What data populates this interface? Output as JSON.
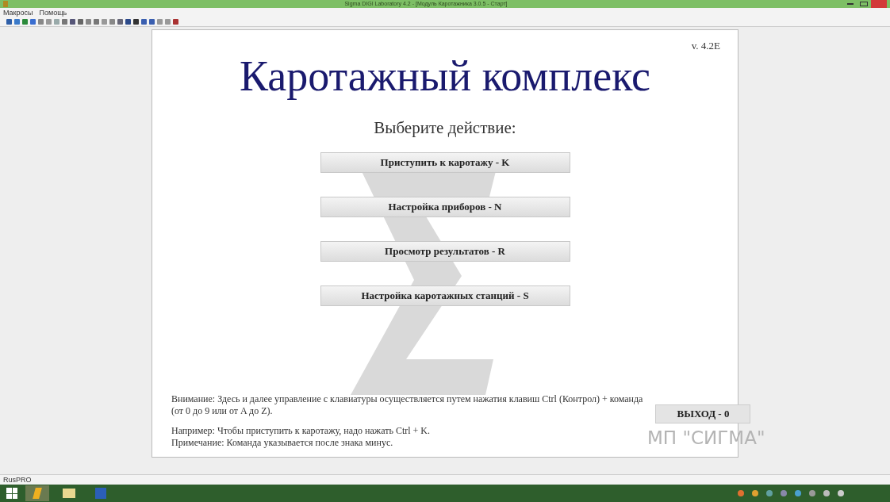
{
  "window": {
    "title": "Sigma DIGI Laboratory 4.2 - [Модуль Каротажника 3.0.5 - Старт]"
  },
  "menu": [
    "Макросы",
    "Помощь"
  ],
  "version": "v. 4.2E",
  "heading": "Каротажный комплекс",
  "prompt": "Выберите действие:",
  "actions": [
    "Приступить к каротажу - K",
    "Настройка приборов - N",
    "Просмотр результатов - R",
    "Настройка каротажных станций - S"
  ],
  "notes": [
    "Внимание: Здесь и далее управление с клавиатуры осуществляется путем нажатия клавиш Ctrl (Контрол) + команда (от 0 до 9 или от A до Z).",
    "Например: Чтобы приступить к каротажу, надо нажать Ctrl + K.",
    "Примечание: Команда указывается после знака минус."
  ],
  "exit_button": "ВЫХОД - 0",
  "brand": "МП \"СИГМА\"",
  "status_bar": "RusPRO"
}
